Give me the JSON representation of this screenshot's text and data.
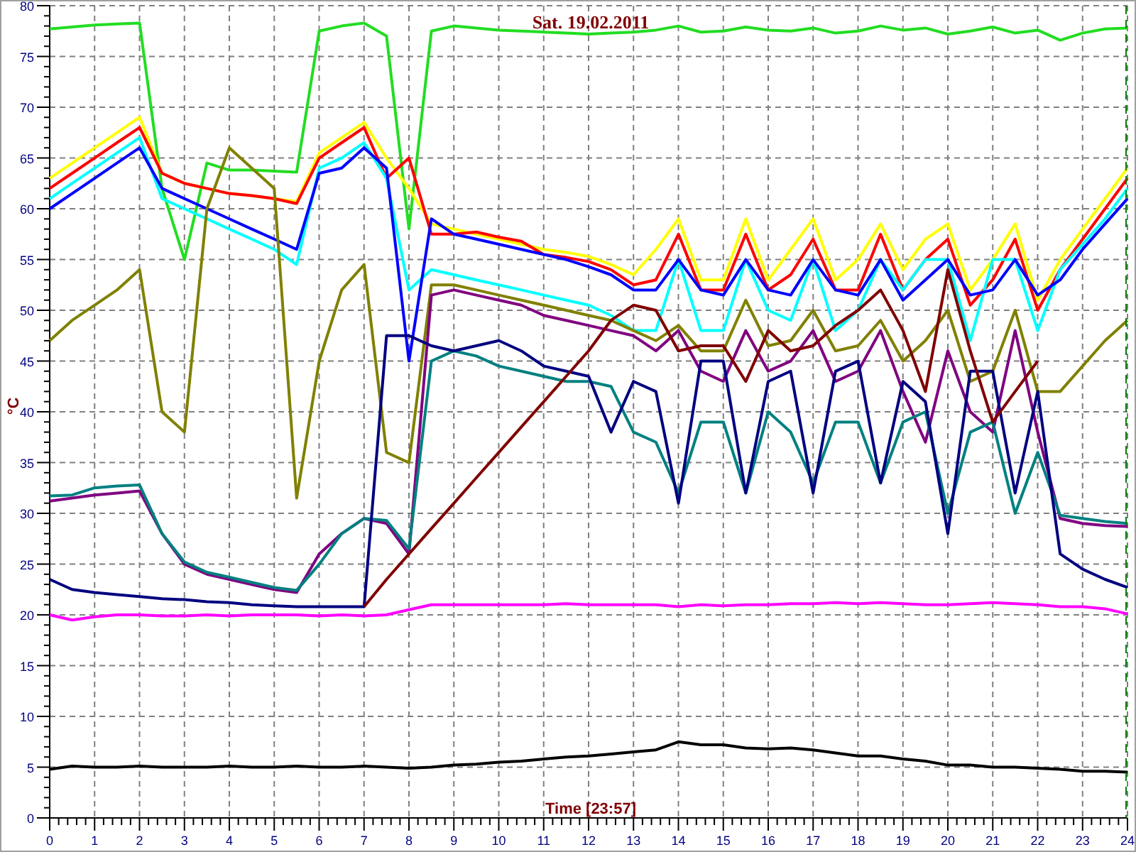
{
  "chart_data": {
    "type": "line",
    "title": "Sat. 19.02.2011",
    "xlabel": "Time [23:57]",
    "ylabel": "°C",
    "x": [
      0,
      0.5,
      1,
      1.5,
      2,
      2.5,
      3,
      3.5,
      4,
      4.5,
      5,
      5.5,
      6,
      6.5,
      7,
      7.5,
      8,
      8.5,
      9,
      9.5,
      10,
      10.5,
      11,
      11.5,
      12,
      12.5,
      13,
      13.5,
      14,
      14.5,
      15,
      15.5,
      16,
      16.5,
      17,
      17.5,
      18,
      18.5,
      19,
      19.5,
      20,
      20.5,
      21,
      21.5,
      22,
      22.5,
      23,
      23.5,
      24
    ],
    "xlim": [
      0,
      24
    ],
    "ylim": [
      0,
      80
    ],
    "xticks": [
      0,
      1,
      2,
      3,
      4,
      5,
      6,
      7,
      8,
      9,
      10,
      11,
      12,
      13,
      14,
      15,
      16,
      17,
      18,
      19,
      20,
      21,
      22,
      23,
      24
    ],
    "yticks": [
      0,
      5,
      10,
      15,
      20,
      25,
      30,
      35,
      40,
      45,
      50,
      55,
      60,
      65,
      70,
      75,
      80
    ],
    "series": [
      {
        "color": "#22dd22",
        "values": [
          77.7,
          77.9,
          78.1,
          78.2,
          78.3,
          62,
          55,
          64.5,
          63.8,
          63.8,
          63.7,
          63.6,
          77.5,
          78,
          78.3,
          77,
          58,
          77.5,
          78,
          77.8,
          77.6,
          77.5,
          77.4,
          77.3,
          77.2,
          77.3,
          77.4,
          77.6,
          78,
          77.4,
          77.5,
          77.9,
          77.6,
          77.5,
          77.8,
          77.3,
          77.5,
          78,
          77.6,
          77.8,
          77.2,
          77.5,
          77.9,
          77.3,
          77.6,
          76.6,
          77.3,
          77.7,
          77.8
        ]
      },
      {
        "color": "#ffff00",
        "values": [
          63,
          64.5,
          66,
          67.5,
          69,
          63.5,
          62.5,
          62,
          61.5,
          61.3,
          61,
          60.7,
          65.5,
          67,
          68.5,
          65,
          62,
          58.5,
          58,
          57.5,
          57,
          56.5,
          56,
          55.7,
          55.3,
          54.5,
          53.5,
          56,
          59,
          53,
          53,
          59,
          53,
          56,
          59,
          53,
          55,
          58.5,
          54,
          57,
          58.5,
          52,
          55,
          58.5,
          51,
          55,
          58,
          61,
          64
        ]
      },
      {
        "color": "#ff0000",
        "values": [
          62,
          63.5,
          65,
          66.5,
          68,
          63.5,
          62.5,
          62,
          61.5,
          61.3,
          61,
          60.5,
          65,
          66.5,
          68,
          63,
          65,
          57.5,
          57.5,
          57.7,
          57.2,
          56.8,
          55.5,
          55.2,
          54.8,
          54,
          52.5,
          53,
          57.5,
          52,
          52,
          57.5,
          52,
          53.5,
          57,
          52,
          52,
          57.5,
          52,
          55,
          57,
          50.5,
          53,
          57,
          50,
          54,
          57,
          60,
          63
        ]
      },
      {
        "color": "#00ffff",
        "values": [
          61,
          62.5,
          64,
          65.5,
          67,
          61,
          60,
          59,
          58,
          57,
          56,
          54.5,
          64,
          65,
          66.5,
          63,
          52,
          54,
          53.5,
          53,
          52.5,
          52,
          51.5,
          51,
          50.5,
          49.5,
          48,
          48,
          55,
          48,
          48,
          55,
          50,
          49,
          55,
          48,
          50,
          55,
          52,
          55,
          55,
          47,
          55,
          55,
          48,
          54,
          56.5,
          59,
          62
        ]
      },
      {
        "color": "#0000ff",
        "values": [
          60,
          61.5,
          63,
          64.5,
          66,
          62,
          61,
          60,
          59,
          58,
          57,
          56,
          63.5,
          64,
          66,
          64,
          45,
          59,
          57.5,
          57,
          56.5,
          56,
          55.5,
          55,
          54.3,
          53.5,
          52,
          52,
          55,
          52,
          51.5,
          55,
          52,
          51.5,
          55,
          52,
          51.5,
          55,
          51,
          53,
          55,
          51.5,
          52,
          55,
          51.5,
          53,
          56,
          58.5,
          61
        ]
      },
      {
        "color": "#808000",
        "values": [
          47,
          49,
          50.5,
          52,
          54,
          40,
          38,
          60,
          66,
          64,
          62,
          31.5,
          45,
          52,
          54.5,
          36,
          35,
          52.5,
          52.5,
          52,
          51.5,
          51,
          50.5,
          50,
          49.5,
          49,
          48,
          47,
          48.5,
          46,
          46,
          51,
          46.5,
          47,
          50,
          46,
          46.5,
          49,
          45,
          47,
          50,
          43,
          44,
          50,
          42,
          42,
          44.5,
          47,
          49
        ]
      },
      {
        "color": "#800080",
        "values": [
          31.2,
          31.5,
          31.8,
          32,
          32.2,
          28,
          25,
          24,
          23.5,
          23,
          22.5,
          22.2,
          26,
          28,
          29.5,
          29,
          26,
          51.5,
          52,
          51.5,
          51,
          50.5,
          49.5,
          49,
          48.5,
          48,
          47.5,
          46,
          48,
          44,
          43,
          48,
          44,
          45,
          48,
          43,
          44,
          48,
          42,
          37,
          46,
          40,
          38,
          48,
          38,
          29.5,
          29,
          28.8,
          28.7
        ]
      },
      {
        "color": "#008080",
        "values": [
          31.7,
          31.8,
          32.5,
          32.7,
          32.8,
          28,
          25.2,
          24.2,
          23.7,
          23.2,
          22.7,
          22.4,
          25,
          28,
          29.5,
          29.3,
          26.5,
          45,
          46,
          45.5,
          44.5,
          44,
          43.5,
          43,
          43,
          42.5,
          38,
          37,
          32,
          39,
          39,
          32,
          40,
          38,
          33,
          39,
          39,
          33,
          39,
          40,
          30,
          38,
          39,
          30,
          36,
          29.8,
          29.5,
          29.2,
          29
        ]
      },
      {
        "color": "#000080",
        "values": [
          23.5,
          22.5,
          22.2,
          22,
          21.8,
          21.6,
          21.5,
          21.3,
          21.2,
          21,
          20.9,
          20.8,
          20.8,
          20.8,
          20.8,
          47.5,
          47.5,
          46.5,
          46,
          46.5,
          47,
          46,
          44.5,
          44,
          43.5,
          38,
          43,
          42,
          31,
          45,
          45,
          32,
          43,
          44,
          32,
          44,
          45,
          33,
          43,
          41,
          28,
          44,
          44,
          32,
          42,
          26,
          24.5,
          23.5,
          22.7
        ]
      },
      {
        "color": "#800000",
        "values": [
          null,
          null,
          null,
          null,
          null,
          null,
          null,
          null,
          null,
          null,
          null,
          null,
          null,
          null,
          20.8,
          23.5,
          26,
          28.5,
          31,
          33.5,
          36,
          38.5,
          41,
          43.5,
          46,
          49,
          50.5,
          50,
          46,
          46.5,
          46.5,
          43,
          48,
          46,
          46.5,
          48.5,
          50,
          52,
          48,
          42,
          54,
          46,
          39,
          42,
          45,
          null,
          null,
          null,
          null
        ]
      },
      {
        "color": "#ff00ff",
        "values": [
          20,
          19.5,
          19.8,
          20,
          20,
          19.9,
          19.9,
          20,
          19.9,
          20,
          20,
          20,
          19.9,
          20,
          19.9,
          20,
          20.5,
          21,
          21,
          21,
          21,
          21,
          21,
          21.1,
          21,
          21,
          21,
          21,
          20.8,
          21,
          20.9,
          21,
          21,
          21.1,
          21.1,
          21.2,
          21.1,
          21.2,
          21.1,
          21,
          21,
          21.1,
          21.2,
          21.1,
          21,
          20.8,
          20.8,
          20.6,
          20.1
        ]
      },
      {
        "color": "#000000",
        "values": [
          4.8,
          5.1,
          5,
          5,
          5.1,
          5,
          5,
          5,
          5.1,
          5,
          5,
          5.1,
          5,
          5,
          5.1,
          5,
          4.9,
          5,
          5.2,
          5.3,
          5.5,
          5.6,
          5.8,
          6,
          6.1,
          6.3,
          6.5,
          6.7,
          7.5,
          7.2,
          7.2,
          6.9,
          6.8,
          6.9,
          6.7,
          6.4,
          6.1,
          6.1,
          5.8,
          5.6,
          5.2,
          5.2,
          5,
          5,
          4.9,
          4.8,
          4.6,
          4.6,
          4.5
        ]
      }
    ],
    "grid": true
  }
}
